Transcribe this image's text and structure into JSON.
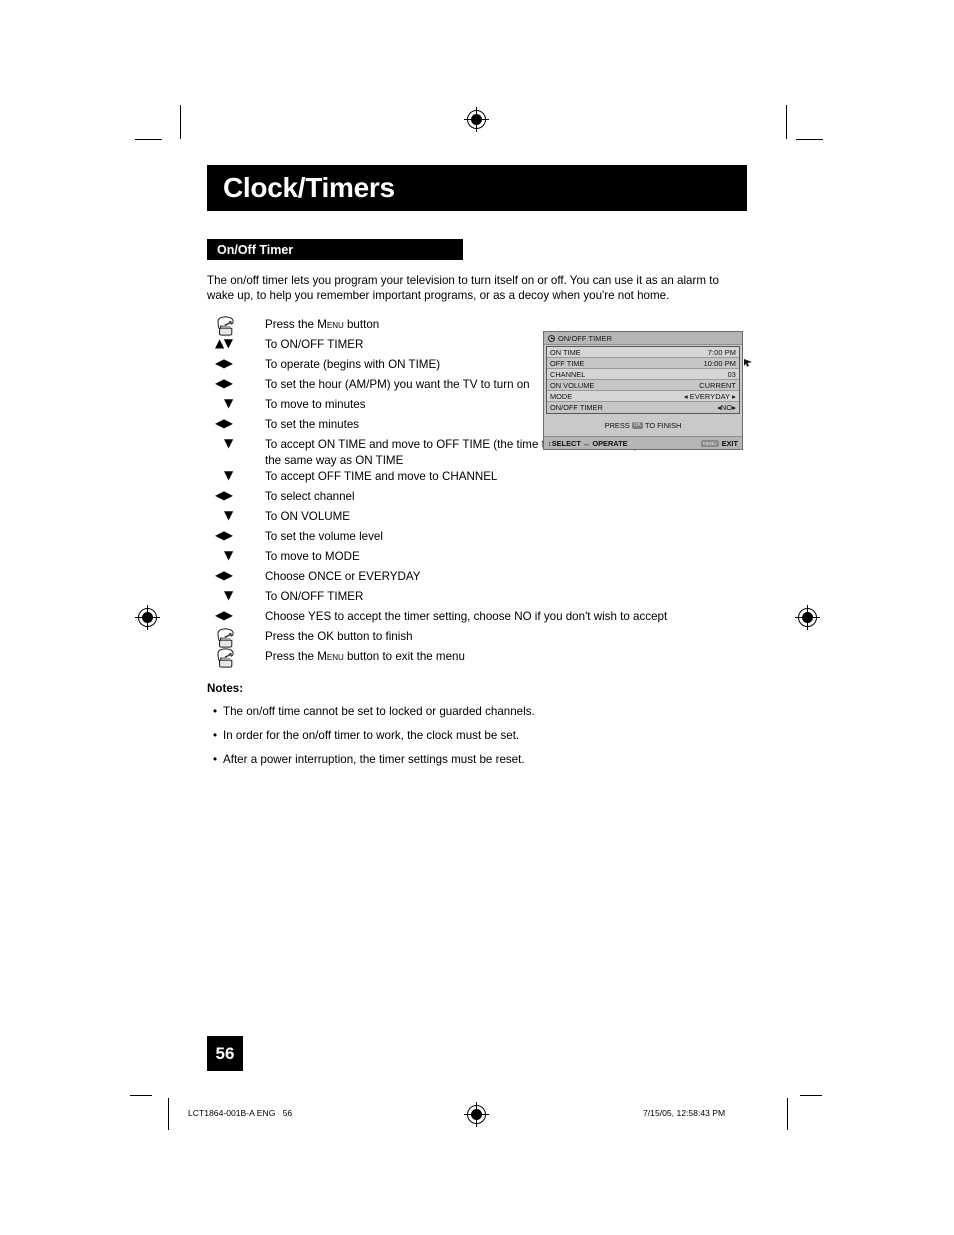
{
  "chapter": {
    "title": "Clock/Timers"
  },
  "section": {
    "title": "On/Off Timer"
  },
  "intro": "The on/off timer lets you program your television to turn itself on or off. You can use it as an alarm to wake up, to help you remember important programs, or as a decoy when you're not home.",
  "steps": [
    {
      "icon": "hand-press-icon",
      "icon_label": "hand",
      "text_pre": "Press the ",
      "text_sc": "Menu",
      "text_post": " button",
      "narrow": true
    },
    {
      "icon": "up-down-arrow-icon",
      "icon_label": "▲▼",
      "text": "To ON/OFF TIMER",
      "narrow": true
    },
    {
      "icon": "left-right-arrow-icon",
      "icon_label": "◀▶",
      "text": "To operate (begins with ON TIME)",
      "narrow": true
    },
    {
      "icon": "left-right-arrow-icon",
      "icon_label": "◀▶",
      "text": "To set the hour (AM/PM) you want the TV to turn on",
      "narrow": true
    },
    {
      "icon": "down-arrow-icon",
      "icon_label": "▼",
      "text": "To move to minutes",
      "narrow": true
    },
    {
      "icon": "left-right-arrow-icon",
      "icon_label": "◀▶",
      "text": "To set the minutes",
      "narrow": true
    },
    {
      "icon": "down-arrow-icon",
      "icon_label": "▼",
      "text": "To accept ON TIME and move to OFF TIME (the time the TV will turn off). Set the OFF TIME the same way as ON TIME",
      "narrow": false
    },
    {
      "icon": "down-arrow-icon",
      "icon_label": "▼",
      "text": "To accept OFF TIME and move to CHANNEL",
      "narrow": false
    },
    {
      "icon": "left-right-arrow-icon",
      "icon_label": "◀▶",
      "text": "To select channel",
      "narrow": false
    },
    {
      "icon": "down-arrow-icon",
      "icon_label": "▼",
      "text": "To ON VOLUME",
      "narrow": false
    },
    {
      "icon": "left-right-arrow-icon",
      "icon_label": "◀▶",
      "text": "To set the volume level",
      "narrow": false
    },
    {
      "icon": "down-arrow-icon",
      "icon_label": "▼",
      "text": "To move to MODE",
      "narrow": false
    },
    {
      "icon": "left-right-arrow-icon",
      "icon_label": "◀▶",
      "text": "Choose ONCE or EVERYDAY",
      "narrow": false
    },
    {
      "icon": "down-arrow-icon",
      "icon_label": "▼",
      "text": "To ON/OFF TIMER",
      "narrow": false
    },
    {
      "icon": "left-right-arrow-icon",
      "icon_label": "◀▶",
      "text": "Choose YES to accept the timer setting, choose NO if you don't wish to accept",
      "narrow": false
    },
    {
      "icon": "hand-press-icon",
      "icon_label": "hand",
      "text": "Press the OK button to finish",
      "narrow": false
    },
    {
      "icon": "hand-press-icon",
      "icon_label": "hand",
      "text_pre": "Press the ",
      "text_sc": "Menu",
      "text_post": " button to exit the menu",
      "narrow": false
    }
  ],
  "notes": {
    "heading": "Notes:",
    "bullet": "•",
    "items": [
      "The on/off time cannot be set to locked or guarded channels.",
      "In order for the on/off timer to work, the clock must be set.",
      "After a power interruption, the timer settings must be reset."
    ]
  },
  "osd": {
    "title": "ON/OFF TIMER",
    "title_icon": "clock-icon",
    "rows": [
      {
        "label": "ON TIME",
        "value": "7:00 PM"
      },
      {
        "label": "OFF TIME",
        "value": "10:00 PM"
      },
      {
        "label": "CHANNEL",
        "value": "03"
      },
      {
        "label": "ON VOLUME",
        "value": "CURRENT"
      },
      {
        "label": "MODE",
        "value": "◂ EVERYDAY ▸"
      },
      {
        "label": "ON/OFF TIMER",
        "value": "◂NO▸"
      }
    ],
    "finish_pre": "PRESS",
    "finish_btn": "OK",
    "finish_post": "TO FINISH",
    "bottom_left": "↕SELECT ↔ OPERATE",
    "bottom_right_btn": "MENU",
    "bottom_right": "EXIT"
  },
  "footer": {
    "page_number": "56",
    "left_text": "LCT1864-001B-A ENG   56",
    "right_text": "7/15/05, 12:58:43 PM"
  },
  "colors": {
    "bar_black": "#000000",
    "osd_bg": "#c9c9c9",
    "osd_row": "#d5d5d5"
  }
}
